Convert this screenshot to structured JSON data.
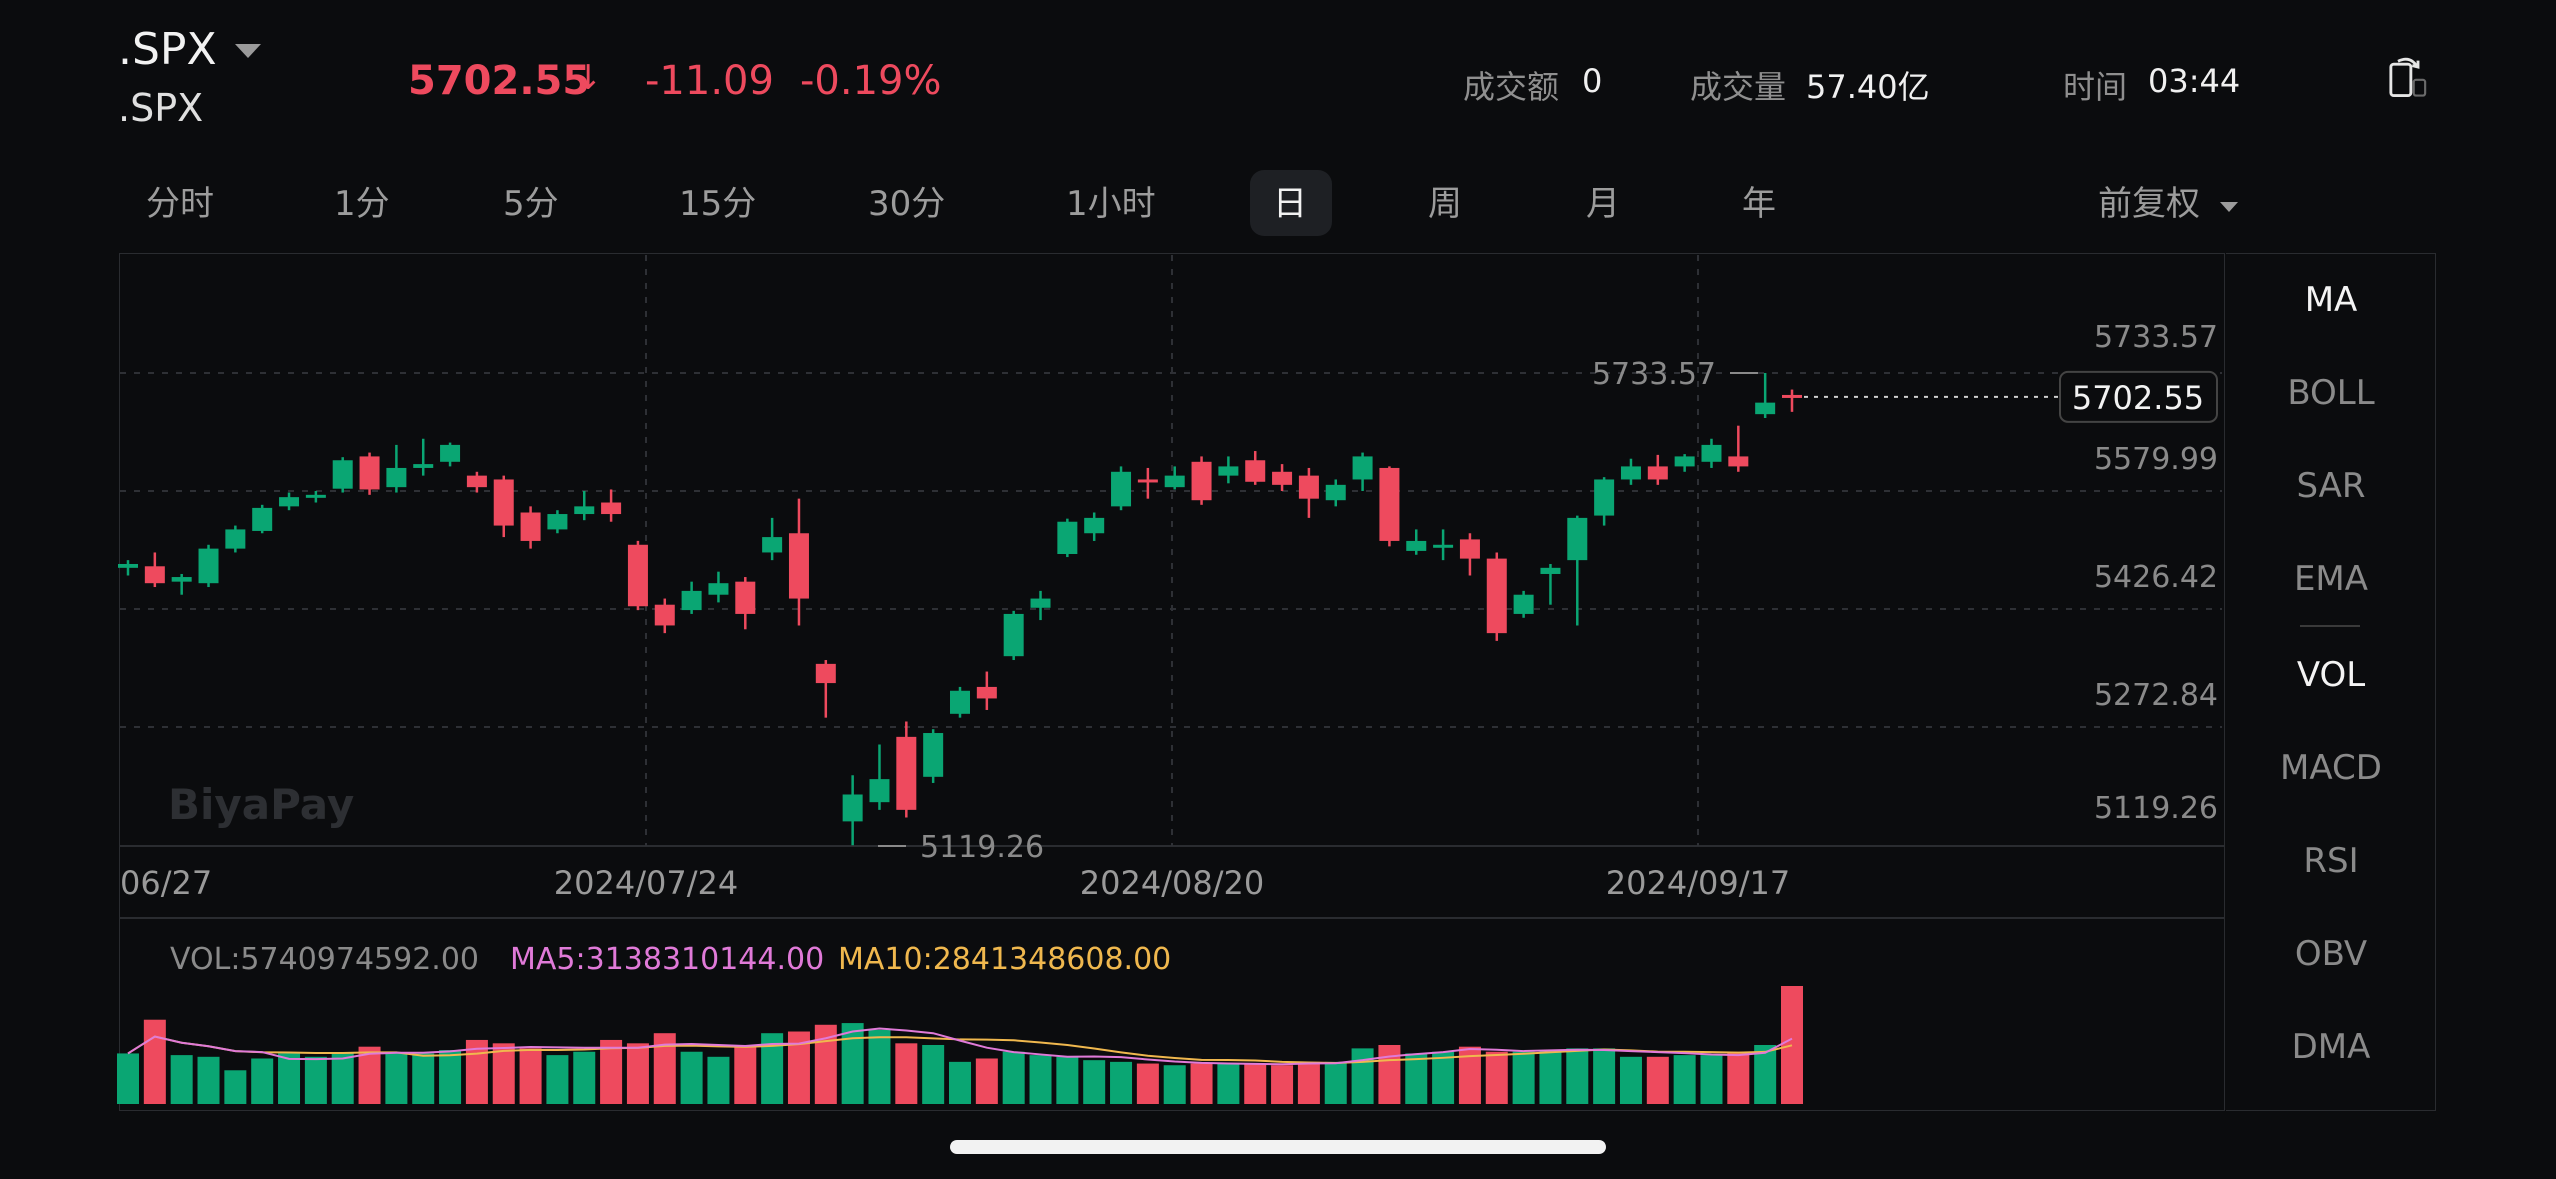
{
  "header": {
    "symbol": ".SPX",
    "sub_symbol": ".SPX",
    "price": "5702.55",
    "arrow": "↓",
    "change": "-11.09",
    "change_pct": "-0.19%",
    "turnover_label": "成交额",
    "turnover_value": "0",
    "volume_label": "成交量",
    "volume_value": "57.40亿",
    "time_label": "时间",
    "time_value": "03:44",
    "colors": {
      "up": "#0aa673",
      "down": "#ee4a5e"
    }
  },
  "tabs": [
    "分时",
    "1分",
    "5分",
    "15分",
    "30分",
    "1小时",
    "日",
    "周",
    "月",
    "年"
  ],
  "active_tab": "日",
  "adjust_label": "前复权",
  "indicators_main": [
    "MA",
    "BOLL",
    "SAR",
    "EMA"
  ],
  "indicators_sub": [
    "VOL",
    "MACD",
    "RSI",
    "OBV",
    "DMA"
  ],
  "watermark": "BiyaPay",
  "chart_data": {
    "type": "candlestick",
    "y_ticks": [
      "5733.57",
      "5579.99",
      "5426.42",
      "5272.84",
      "5119.26"
    ],
    "ylim": [
      5119.26,
      5733.57
    ],
    "last_price_label": "5702.55",
    "high_label": "5733.57",
    "low_label": "5119.26",
    "x_labels": [
      "06/27",
      "2024/07/24",
      "2024/08/20",
      "2024/09/17"
    ],
    "candles": [
      [
        5480,
        5485,
        5470,
        5490
      ],
      [
        5482,
        5460,
        5455,
        5500
      ],
      [
        5462,
        5468,
        5445,
        5472
      ],
      [
        5460,
        5505,
        5455,
        5510
      ],
      [
        5505,
        5530,
        5500,
        5535
      ],
      [
        5528,
        5558,
        5525,
        5562
      ],
      [
        5560,
        5572,
        5555,
        5578
      ],
      [
        5572,
        5575,
        5565,
        5580
      ],
      [
        5583,
        5620,
        5578,
        5624
      ],
      [
        5625,
        5582,
        5575,
        5630
      ],
      [
        5585,
        5610,
        5578,
        5640
      ],
      [
        5610,
        5615,
        5600,
        5648
      ],
      [
        5618,
        5640,
        5612,
        5643
      ],
      [
        5600,
        5585,
        5578,
        5605
      ],
      [
        5595,
        5535,
        5520,
        5600
      ],
      [
        5552,
        5515,
        5505,
        5560
      ],
      [
        5530,
        5550,
        5525,
        5555
      ],
      [
        5550,
        5560,
        5542,
        5580
      ],
      [
        5565,
        5550,
        5540,
        5582
      ],
      [
        5510,
        5430,
        5425,
        5515
      ],
      [
        5432,
        5405,
        5395,
        5440
      ],
      [
        5425,
        5450,
        5420,
        5462
      ],
      [
        5445,
        5460,
        5435,
        5475
      ],
      [
        5462,
        5420,
        5400,
        5468
      ],
      [
        5500,
        5520,
        5490,
        5545
      ],
      [
        5525,
        5440,
        5405,
        5570
      ],
      [
        5355,
        5330,
        5285,
        5360
      ],
      [
        5150,
        5185,
        5119,
        5210
      ],
      [
        5175,
        5205,
        5165,
        5250
      ],
      [
        5260,
        5165,
        5155,
        5280
      ],
      [
        5208,
        5265,
        5200,
        5270
      ],
      [
        5290,
        5320,
        5285,
        5325
      ],
      [
        5325,
        5310,
        5295,
        5345
      ],
      [
        5365,
        5420,
        5360,
        5424
      ],
      [
        5428,
        5440,
        5412,
        5450
      ],
      [
        5498,
        5540,
        5494,
        5544
      ],
      [
        5525,
        5545,
        5515,
        5552
      ],
      [
        5560,
        5605,
        5555,
        5612
      ],
      [
        5595,
        5592,
        5570,
        5610
      ],
      [
        5585,
        5600,
        5582,
        5612
      ],
      [
        5618,
        5568,
        5562,
        5625
      ],
      [
        5600,
        5612,
        5590,
        5625
      ],
      [
        5620,
        5592,
        5588,
        5632
      ],
      [
        5605,
        5588,
        5580,
        5615
      ],
      [
        5600,
        5570,
        5545,
        5610
      ],
      [
        5568,
        5588,
        5560,
        5595
      ],
      [
        5595,
        5625,
        5580,
        5630
      ],
      [
        5610,
        5515,
        5508,
        5612
      ],
      [
        5502,
        5515,
        5497,
        5530
      ],
      [
        5510,
        5510,
        5490,
        5530
      ],
      [
        5517,
        5492,
        5470,
        5525
      ],
      [
        5492,
        5395,
        5385,
        5500
      ],
      [
        5420,
        5445,
        5415,
        5450
      ],
      [
        5472,
        5480,
        5432,
        5485
      ],
      [
        5490,
        5545,
        5405,
        5548
      ],
      [
        5548,
        5595,
        5535,
        5598
      ],
      [
        5595,
        5612,
        5588,
        5622
      ],
      [
        5612,
        5595,
        5588,
        5627
      ],
      [
        5612,
        5625,
        5605,
        5628
      ],
      [
        5618,
        5640,
        5610,
        5648
      ],
      [
        5625,
        5612,
        5605,
        5665
      ],
      [
        5680,
        5695,
        5675,
        5733.57
      ],
      [
        5705,
        5702.55,
        5683,
        5712
      ]
    ],
    "volume": {
      "label": "VOL:5740974592.00",
      "ma5_label": "MA5:3138310144.00",
      "ma10_label": "MA10:2841348608.00",
      "ma5_color": "#e07ad8",
      "ma10_color": "#f0b84e",
      "bars": [
        3.0,
        5.0,
        2.9,
        2.8,
        2.0,
        2.7,
        3.0,
        2.8,
        3.0,
        3.4,
        3.0,
        3.0,
        3.2,
        3.8,
        3.6,
        3.3,
        2.9,
        3.1,
        3.8,
        3.6,
        4.2,
        3.1,
        2.8,
        3.5,
        4.2,
        4.3,
        4.7,
        4.8,
        4.4,
        3.6,
        3.5,
        2.5,
        2.7,
        3.1,
        2.9,
        2.8,
        2.6,
        2.5,
        2.4,
        2.3,
        2.4,
        2.4,
        2.4,
        2.3,
        2.5,
        2.5,
        3.3,
        3.5,
        3.0,
        3.1,
        3.4,
        3.1,
        3.1,
        3.2,
        3.3,
        3.3,
        2.8,
        2.8,
        2.9,
        2.9,
        3.1,
        3.5,
        7.0
      ]
    }
  }
}
